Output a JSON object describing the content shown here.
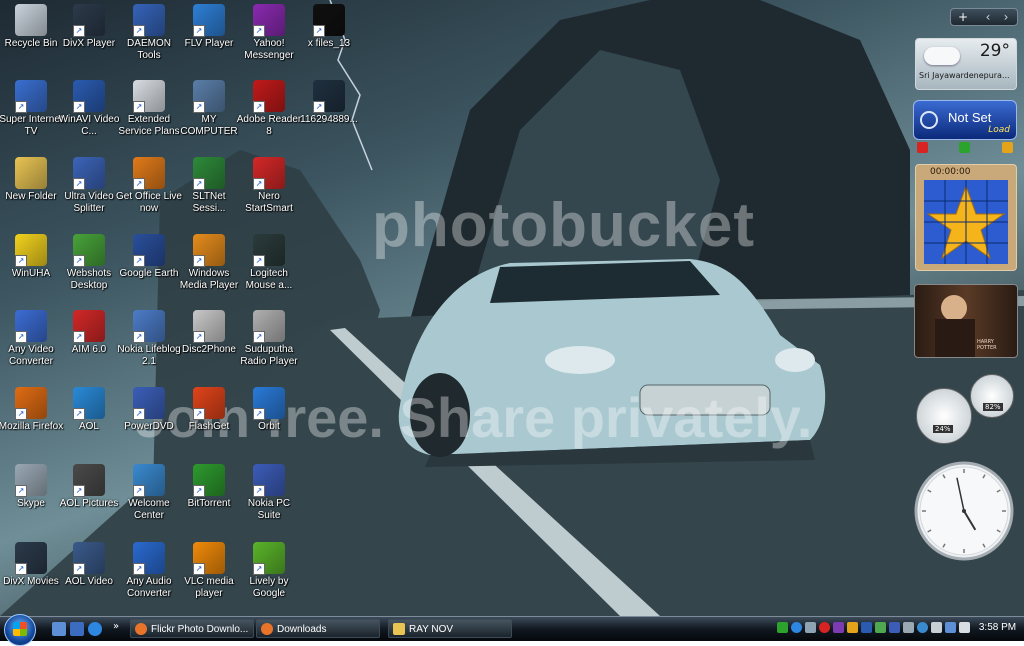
{
  "desktop_icons": [
    {
      "label": "Recycle Bin",
      "color": "#c9d3dc"
    },
    {
      "label": "DivX Player",
      "color": "#2b3a4a"
    },
    {
      "label": "DAEMON Tools",
      "color": "#3563b8"
    },
    {
      "label": "FLV Player",
      "color": "#2e7fd6"
    },
    {
      "label": "Yahoo! Messenger",
      "color": "#8a2ab0"
    },
    {
      "label": "x files_13",
      "color": "#101010"
    },
    {
      "label": "Super Internet TV",
      "color": "#3a6fd0"
    },
    {
      "label": "WinAVI Video C...",
      "color": "#2a5bb0"
    },
    {
      "label": "Extended Service Plans",
      "color": "#d8dde3"
    },
    {
      "label": "MY COMPUTER",
      "color": "#5a7ea8"
    },
    {
      "label": "Adobe Reader 8",
      "color": "#c01a1a"
    },
    {
      "label": "116294889...",
      "color": "#203040"
    },
    {
      "label": "New Folder",
      "color": "#e8c454"
    },
    {
      "label": "Ultra Video Splitter",
      "color": "#3c64b8"
    },
    {
      "label": "Get Office Live now",
      "color": "#e07a1a"
    },
    {
      "label": "SLTNet Sessi...",
      "color": "#2e8a3a"
    },
    {
      "label": "Nero StartSmart",
      "color": "#d42828"
    },
    {
      "label": "WinUHA",
      "color": "#f2d21e"
    },
    {
      "label": "Webshots Desktop",
      "color": "#48a23a"
    },
    {
      "label": "Google Earth",
      "color": "#2a4f9c"
    },
    {
      "label": "Windows Media Player",
      "color": "#e58c1c"
    },
    {
      "label": "Logitech Mouse a...",
      "color": "#2b3b3b"
    },
    {
      "label": "Any Video Converter",
      "color": "#3c6cd4"
    },
    {
      "label": "AIM 6.0",
      "color": "#d22828"
    },
    {
      "label": "Nokia Lifeblog 2.1",
      "color": "#4c7cc8"
    },
    {
      "label": "Disc2Phone",
      "color": "#c8c8c8"
    },
    {
      "label": "Suduputha Radio Player",
      "color": "#b0b0b0"
    },
    {
      "label": "Mozilla Firefox",
      "color": "#e06c14"
    },
    {
      "label": "AOL",
      "color": "#2a8ad8"
    },
    {
      "label": "PowerDVD",
      "color": "#3b5fb8"
    },
    {
      "label": "FlashGet",
      "color": "#e0441a"
    },
    {
      "label": "Orbit",
      "color": "#2a7ad8"
    },
    {
      "label": "Skype",
      "color": "#9aa8b4"
    },
    {
      "label": "AOL Pictures",
      "color": "#4a4a4a"
    },
    {
      "label": "Welcome Center",
      "color": "#3a8ad0"
    },
    {
      "label": "BitTorrent",
      "color": "#2e9a2e"
    },
    {
      "label": "Nokia PC Suite",
      "color": "#3c5cb8"
    },
    {
      "label": "DivX Movies",
      "color": "#2b3a4a"
    },
    {
      "label": "AOL Video",
      "color": "#3a5a8a"
    },
    {
      "label": "Any Audio Converter",
      "color": "#2a6ad0"
    },
    {
      "label": "VLC media player",
      "color": "#f08a0a"
    },
    {
      "label": "Lively by Google",
      "color": "#5ab42a"
    }
  ],
  "watermark": {
    "line1": "photobucket",
    "line2": "Join free. Share privately."
  },
  "gadgets": {
    "sidebar_controls": {
      "add": "+",
      "prev": "‹",
      "next": "›"
    },
    "weather": {
      "temp": "29°",
      "location": "Sri Jayawardenepura..."
    },
    "status": {
      "title": "Not Set",
      "sub": "Load"
    },
    "puzzle": {
      "timer": "00:00:00"
    },
    "photo": {
      "caption": "HARRY POTTER"
    },
    "cpu_meter": {
      "cpu": "24%",
      "ram": "82%"
    },
    "clock": {
      "hour": 4,
      "minute": 58
    }
  },
  "taskbar": {
    "start_label": "Start",
    "tasks": [
      {
        "label": "Flickr Photo Downlo...",
        "icon_color": "#e8742a"
      },
      {
        "label": "Downloads",
        "icon_color": "#e8742a"
      },
      {
        "label": "RAY NOV",
        "icon_color": "#e8c454"
      }
    ],
    "time": "3:58 PM"
  }
}
